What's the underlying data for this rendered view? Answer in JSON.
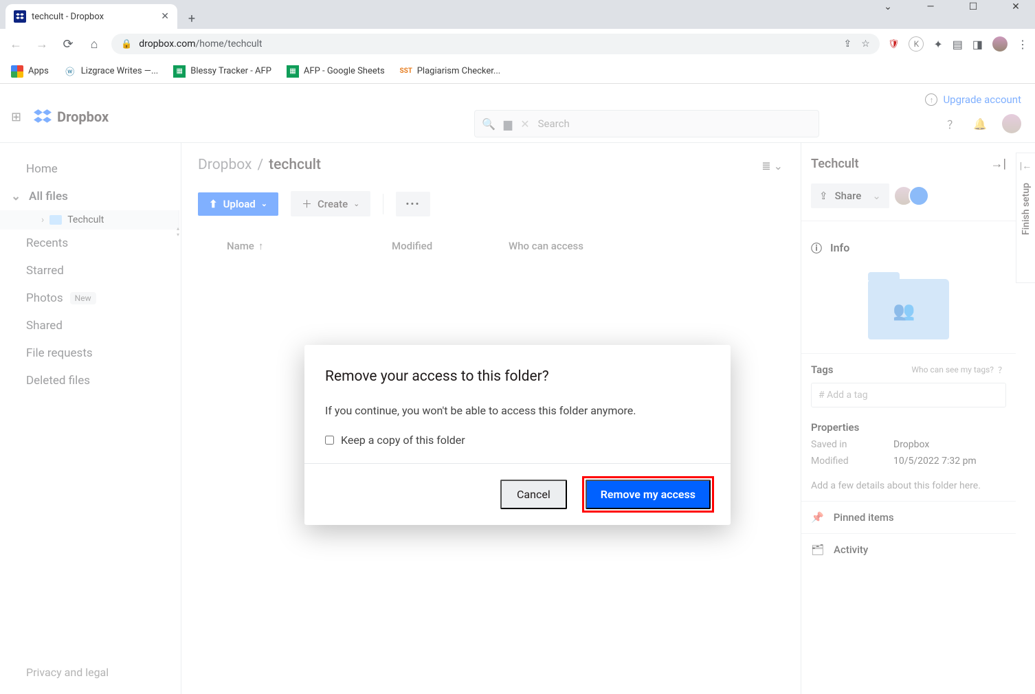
{
  "browser": {
    "tab_title": "techcult - Dropbox",
    "url_host": "dropbox.com",
    "url_path": "/home/techcult"
  },
  "bookmarks": [
    {
      "label": "Apps"
    },
    {
      "label": "Lizgrace Writes —..."
    },
    {
      "label": "Blessy Tracker - AFP"
    },
    {
      "label": "AFP - Google Sheets"
    },
    {
      "label": "Plagiarism Checker..."
    }
  ],
  "topbar": {
    "upgrade": "Upgrade account",
    "brand": "Dropbox",
    "search_placeholder": "Search"
  },
  "sidebar": {
    "items": [
      {
        "label": "Home"
      },
      {
        "label": "All files"
      },
      {
        "label": "Recents"
      },
      {
        "label": "Starred"
      },
      {
        "label": "Photos",
        "badge": "New"
      },
      {
        "label": "Shared"
      },
      {
        "label": "File requests"
      },
      {
        "label": "Deleted files"
      }
    ],
    "sub_item": "Techcult",
    "footer": "Privacy and legal"
  },
  "main": {
    "crumb_root": "Dropbox",
    "crumb_current": "techcult",
    "upload_label": "Upload",
    "create_label": "Create",
    "col_name": "Name",
    "col_modified": "Modified",
    "col_access": "Who can access"
  },
  "details": {
    "title": "Techcult",
    "share": "Share",
    "info": "Info",
    "tags_label": "Tags",
    "tags_hint": "Who can see my tags?",
    "tag_placeholder": "# Add a tag",
    "props_label": "Properties",
    "prop_saved_k": "Saved in",
    "prop_saved_v": "Dropbox",
    "prop_mod_k": "Modified",
    "prop_mod_v": "10/5/2022 7:32 pm",
    "note": "Add a few details about this folder here.",
    "pinned": "Pinned items",
    "activity": "Activity",
    "finish": "Finish setup"
  },
  "modal": {
    "title": "Remove your access to this folder?",
    "text": "If you continue, you won't be able to access this folder anymore.",
    "checkbox_label": "Keep a copy of this folder",
    "cancel": "Cancel",
    "confirm": "Remove my access"
  }
}
